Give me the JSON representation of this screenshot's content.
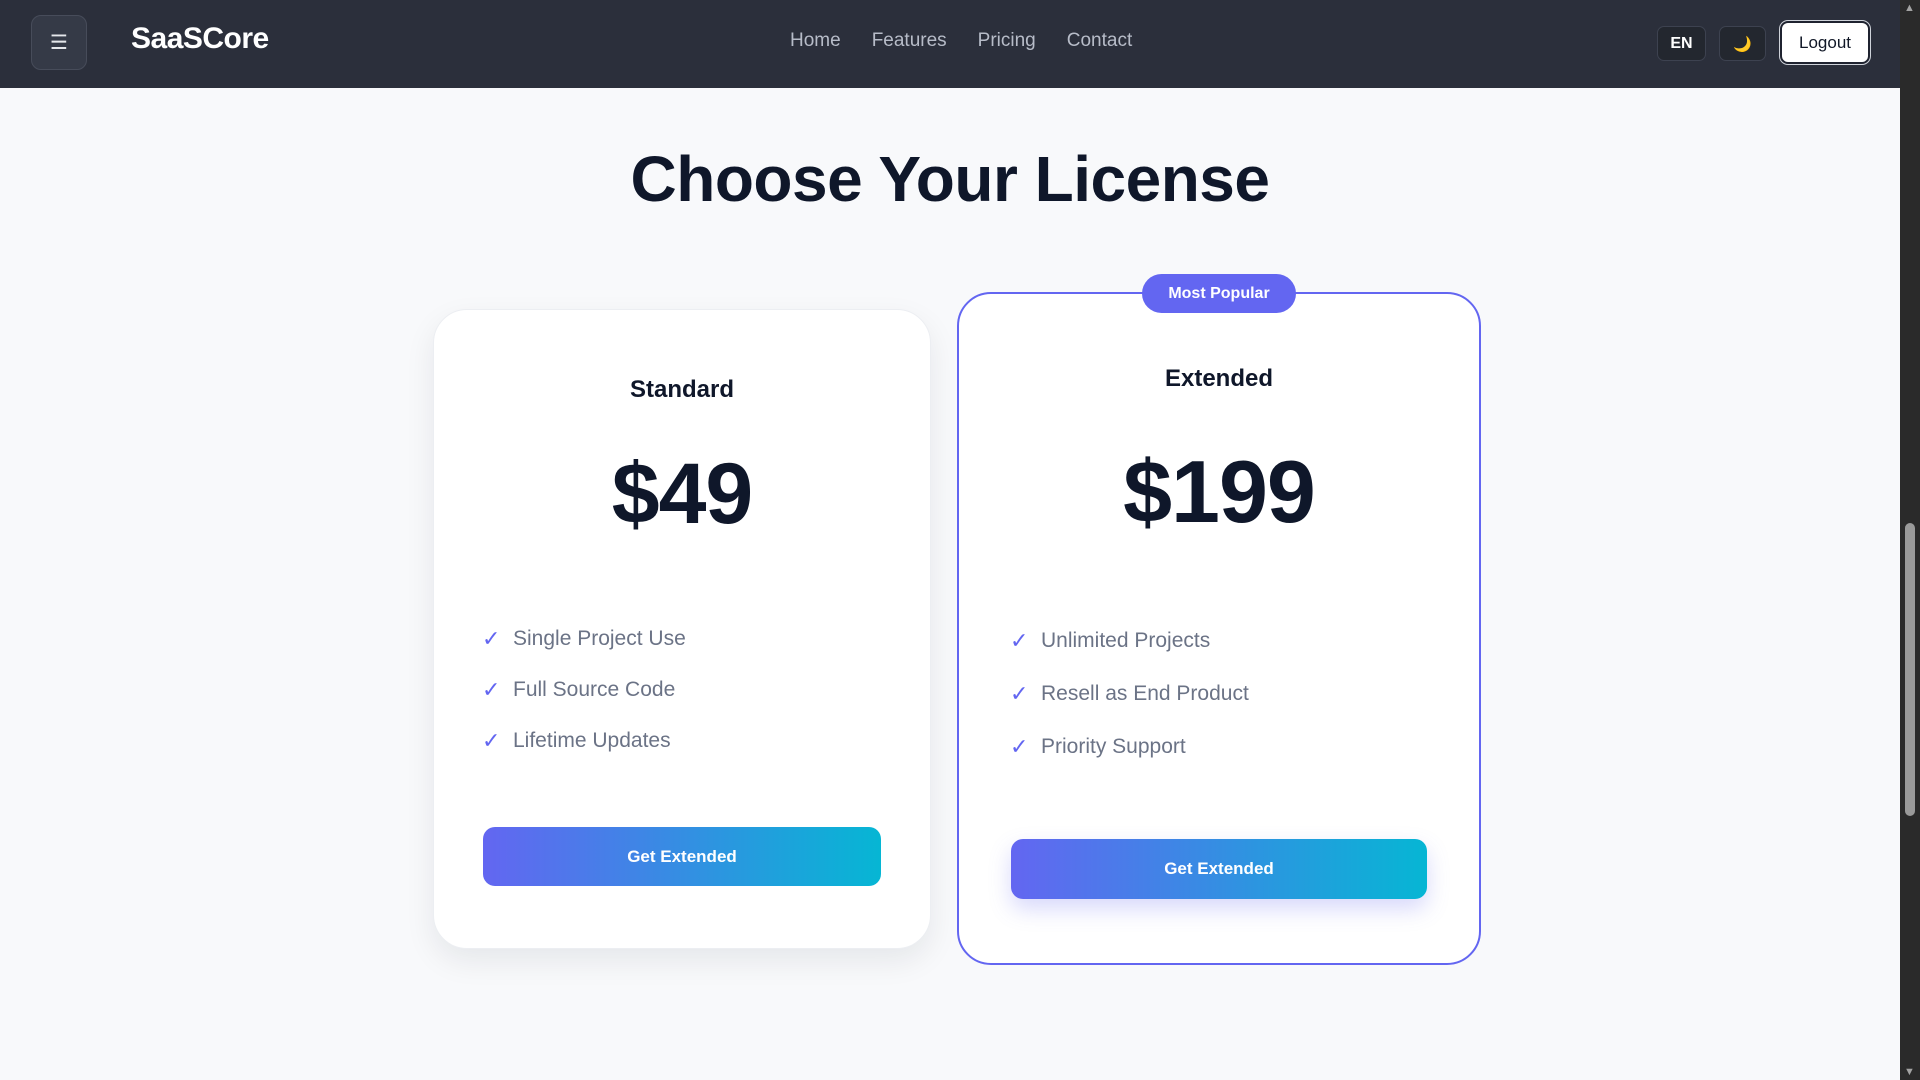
{
  "navbar": {
    "menu_icon": "☰",
    "brand": "SaaSCore",
    "links": [
      "Home",
      "Features",
      "Pricing",
      "Contact"
    ],
    "lang_label": "EN",
    "theme_icon": "🌙",
    "logout_label": "Logout"
  },
  "page": {
    "heading": "Choose Your License"
  },
  "plans": [
    {
      "name": "Standard",
      "price": "$49",
      "features": [
        "Single Project Use",
        "Full Source Code",
        "Lifetime Updates"
      ],
      "cta_label": "Get Extended"
    },
    {
      "name": "Extended",
      "badge": "Most Popular",
      "price": "$199",
      "features": [
        "Unlimited Projects",
        "Resell as End Product",
        "Priority Support"
      ],
      "cta_label": "Get Extended"
    }
  ],
  "icons": {
    "check": "✓"
  },
  "colors": {
    "accent": "#6366f1",
    "gradient_end": "#06b6d4",
    "navbar_bg": "#2b2f3b"
  }
}
